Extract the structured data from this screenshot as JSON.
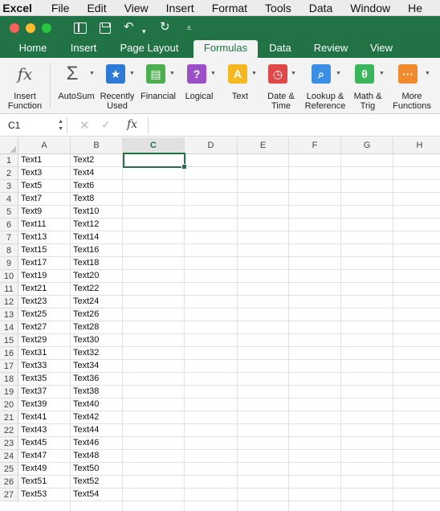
{
  "menubar": {
    "app": "Excel",
    "items": [
      "File",
      "Edit",
      "View",
      "Insert",
      "Format",
      "Tools",
      "Data",
      "Window",
      "He"
    ]
  },
  "quick_access": {
    "icons": [
      "sidebar-icon",
      "save-icon",
      "undo-icon",
      "redo-icon",
      "customize-icon"
    ]
  },
  "tabs": [
    {
      "label": "Home",
      "active": false
    },
    {
      "label": "Insert",
      "active": false
    },
    {
      "label": "Page Layout",
      "active": false
    },
    {
      "label": "Formulas",
      "active": true
    },
    {
      "label": "Data",
      "active": false
    },
    {
      "label": "Review",
      "active": false
    },
    {
      "label": "View",
      "active": false
    }
  ],
  "ribbon": {
    "insert_function": {
      "label": "Insert\nFunction",
      "glyph": "fx"
    },
    "autosum": {
      "label": "AutoSum",
      "glyph": "Σ"
    },
    "recently_used": {
      "label": "Recently\nUsed",
      "glyph": "★",
      "color": "#2d7bd6"
    },
    "financial": {
      "label": "Financial",
      "glyph": "▤",
      "color": "#4caf50"
    },
    "logical": {
      "label": "Logical",
      "glyph": "?",
      "color": "#9c4fc7"
    },
    "text": {
      "label": "Text",
      "glyph": "A",
      "color": "#f5b820"
    },
    "date_time": {
      "label": "Date &\nTime",
      "glyph": "◷",
      "color": "#e04848"
    },
    "lookup_reference": {
      "label": "Lookup &\nReference",
      "glyph": "⌕",
      "color": "#3a8ee6"
    },
    "math_trig": {
      "label": "Math &\nTrig",
      "glyph": "θ",
      "color": "#3bb55b"
    },
    "more_functions": {
      "label": "More\nFunctions",
      "glyph": "···",
      "color": "#f08a2c"
    }
  },
  "formula_bar": {
    "name_box": "C1",
    "formula": ""
  },
  "grid": {
    "columns": [
      "A",
      "B",
      "C",
      "D",
      "E",
      "F",
      "G",
      "H"
    ],
    "selected_column": "C",
    "rows": [
      [
        "1",
        "Text1",
        "Text2"
      ],
      [
        "2",
        "Text3",
        "Text4"
      ],
      [
        "3",
        "Text5",
        "Text6"
      ],
      [
        "4",
        "Text7",
        "Text8"
      ],
      [
        "5",
        "Text9",
        "Text10"
      ],
      [
        "6",
        "Text11",
        "Text12"
      ],
      [
        "7",
        "Text13",
        "Text14"
      ],
      [
        "8",
        "Text15",
        "Text16"
      ],
      [
        "9",
        "Text17",
        "Text18"
      ],
      [
        "10",
        "Text19",
        "Text20"
      ],
      [
        "11",
        "Text21",
        "Text22"
      ],
      [
        "12",
        "Text23",
        "Text24"
      ],
      [
        "13",
        "Text25",
        "Text26"
      ],
      [
        "14",
        "Text27",
        "Text28"
      ],
      [
        "15",
        "Text29",
        "Text30"
      ],
      [
        "16",
        "Text31",
        "Text32"
      ],
      [
        "17",
        "Text33",
        "Text34"
      ],
      [
        "18",
        "Text35",
        "Text36"
      ],
      [
        "19",
        "Text37",
        "Text38"
      ],
      [
        "20",
        "Text39",
        "Text40"
      ],
      [
        "21",
        "Text41",
        "Text42"
      ],
      [
        "22",
        "Text43",
        "Text44"
      ],
      [
        "23",
        "Text45",
        "Text46"
      ],
      [
        "24",
        "Text47",
        "Text48"
      ],
      [
        "25",
        "Text49",
        "Text50"
      ],
      [
        "26",
        "Text51",
        "Text52"
      ],
      [
        "27",
        "Text53",
        "Text54"
      ]
    ]
  },
  "colors": {
    "brand_green": "#217346"
  }
}
